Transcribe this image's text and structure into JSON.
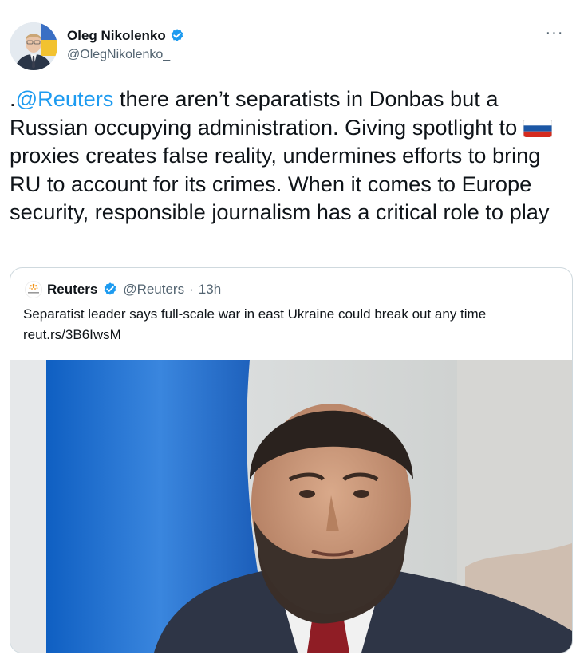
{
  "author": {
    "display_name": "Oleg Nikolenko",
    "handle": "@OlegNikolenko_",
    "more_label": "···"
  },
  "tweet": {
    "mention": "@Reuters",
    "text_prefix": ".",
    "text_part1": " there aren’t separatists in Donbas but a Russian occupying administration. Giving spotlight to ",
    "text_part2": "proxies creates false reality, undermines efforts to bring RU to account for its crimes. When it comes to Europe security, responsible journalism has a critical role to play"
  },
  "quoted": {
    "display_name": "Reuters",
    "handle": "@Reuters",
    "separator": "·",
    "time": "13h",
    "text": "Separatist leader says full-scale war in east Ukraine could break out any time",
    "link": "reut.rs/3B6IwsM"
  },
  "icons": {
    "verified": "verified-badge-icon",
    "more": "more-icon",
    "flag": "russia-flag-emoji",
    "reuters_logo": "reuters-logo"
  },
  "colors": {
    "accent": "#1d9bf0",
    "text": "#0f1419",
    "secondary": "#536471",
    "border": "#cfd9de"
  }
}
